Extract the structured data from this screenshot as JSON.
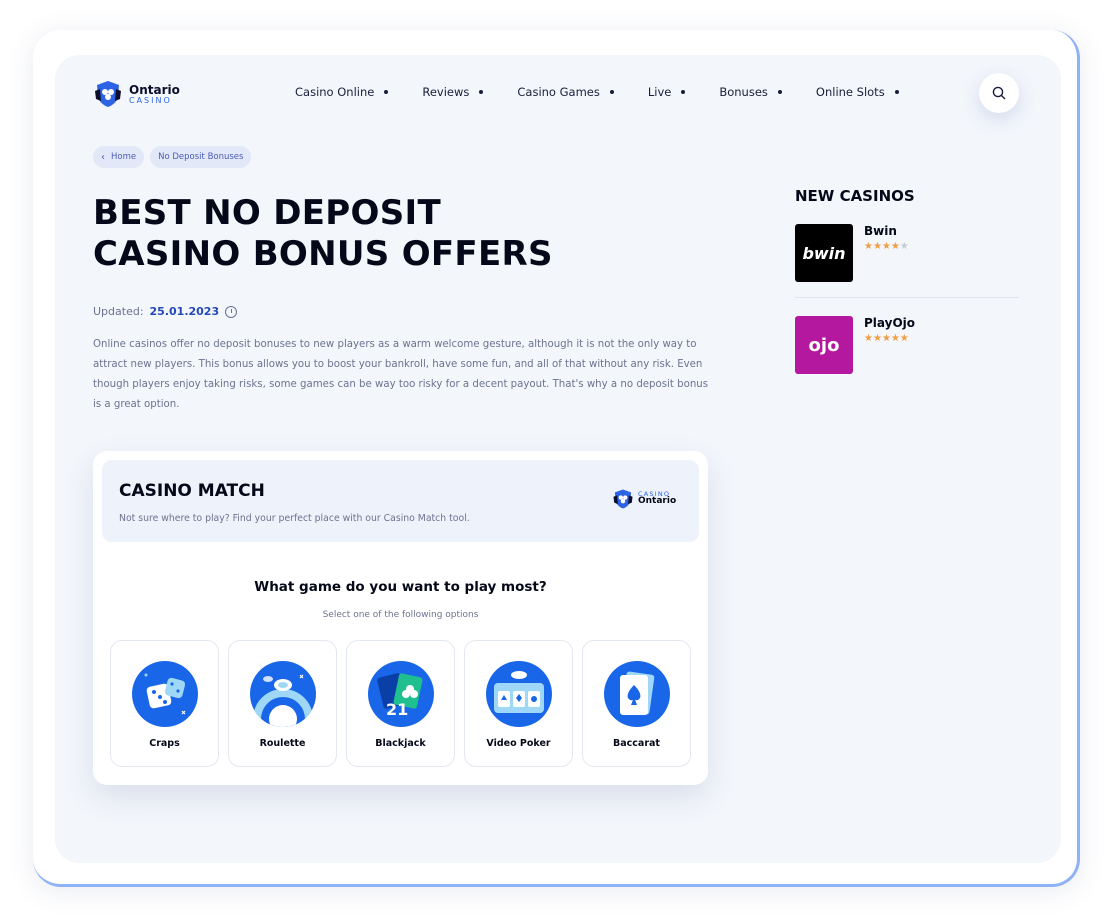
{
  "brand": {
    "name": "Ontario",
    "sub": "CASINO"
  },
  "nav": [
    {
      "label": "Casino Online"
    },
    {
      "label": "Reviews"
    },
    {
      "label": "Casino Games"
    },
    {
      "label": "Live"
    },
    {
      "label": "Bonuses"
    },
    {
      "label": "Online Slots"
    }
  ],
  "search": {
    "icon": "search-icon"
  },
  "breadcrumbs": [
    {
      "label": "Home",
      "icon": "chevron-left-icon"
    },
    {
      "label": "No Deposit Bonuses"
    }
  ],
  "page": {
    "title_line1": "BEST NO DEPOSIT",
    "title_line2": "CASINO BONUS OFFERS",
    "updated_label": "Updated:",
    "updated_date": "25.01.2023",
    "intro": "Online casinos offer no deposit bonuses to new players as a warm welcome gesture, although it is not the only way to attract new players. This bonus allows you to boost your bankroll, have some fun, and all of that without any risk. Even though players enjoy taking risks, some games can be way too risky for a decent payout. That's why a no deposit bonus is a great option."
  },
  "sidebar": {
    "title": "NEW CASINOS",
    "casinos": [
      {
        "name": "Bwin",
        "logo_text": "bwin",
        "logo_bg": "#000000",
        "rating": 4
      },
      {
        "name": "PlayOjo",
        "logo_text": "ojo",
        "logo_bg": "#b3189f",
        "rating": 5
      }
    ]
  },
  "casino_match": {
    "title": "CASINO MATCH",
    "subtitle": "Not sure where to play? Find your perfect place with our Casino Match tool.",
    "logo_top": "CASINO",
    "logo_bottom": "Ontario",
    "question": "What game do you want to play most?",
    "hint": "Select one of the following options",
    "options": [
      {
        "label": "Craps",
        "icon": "dice-icon"
      },
      {
        "label": "Roulette",
        "icon": "roulette-icon"
      },
      {
        "label": "Blackjack",
        "icon": "cards-icon"
      },
      {
        "label": "Video Poker",
        "icon": "video-poker-icon"
      },
      {
        "label": "Baccarat",
        "icon": "spade-card-icon"
      }
    ]
  },
  "colors": {
    "accent": "#2d63e5",
    "star": "#f29d43",
    "background": "#f3f6fb"
  }
}
